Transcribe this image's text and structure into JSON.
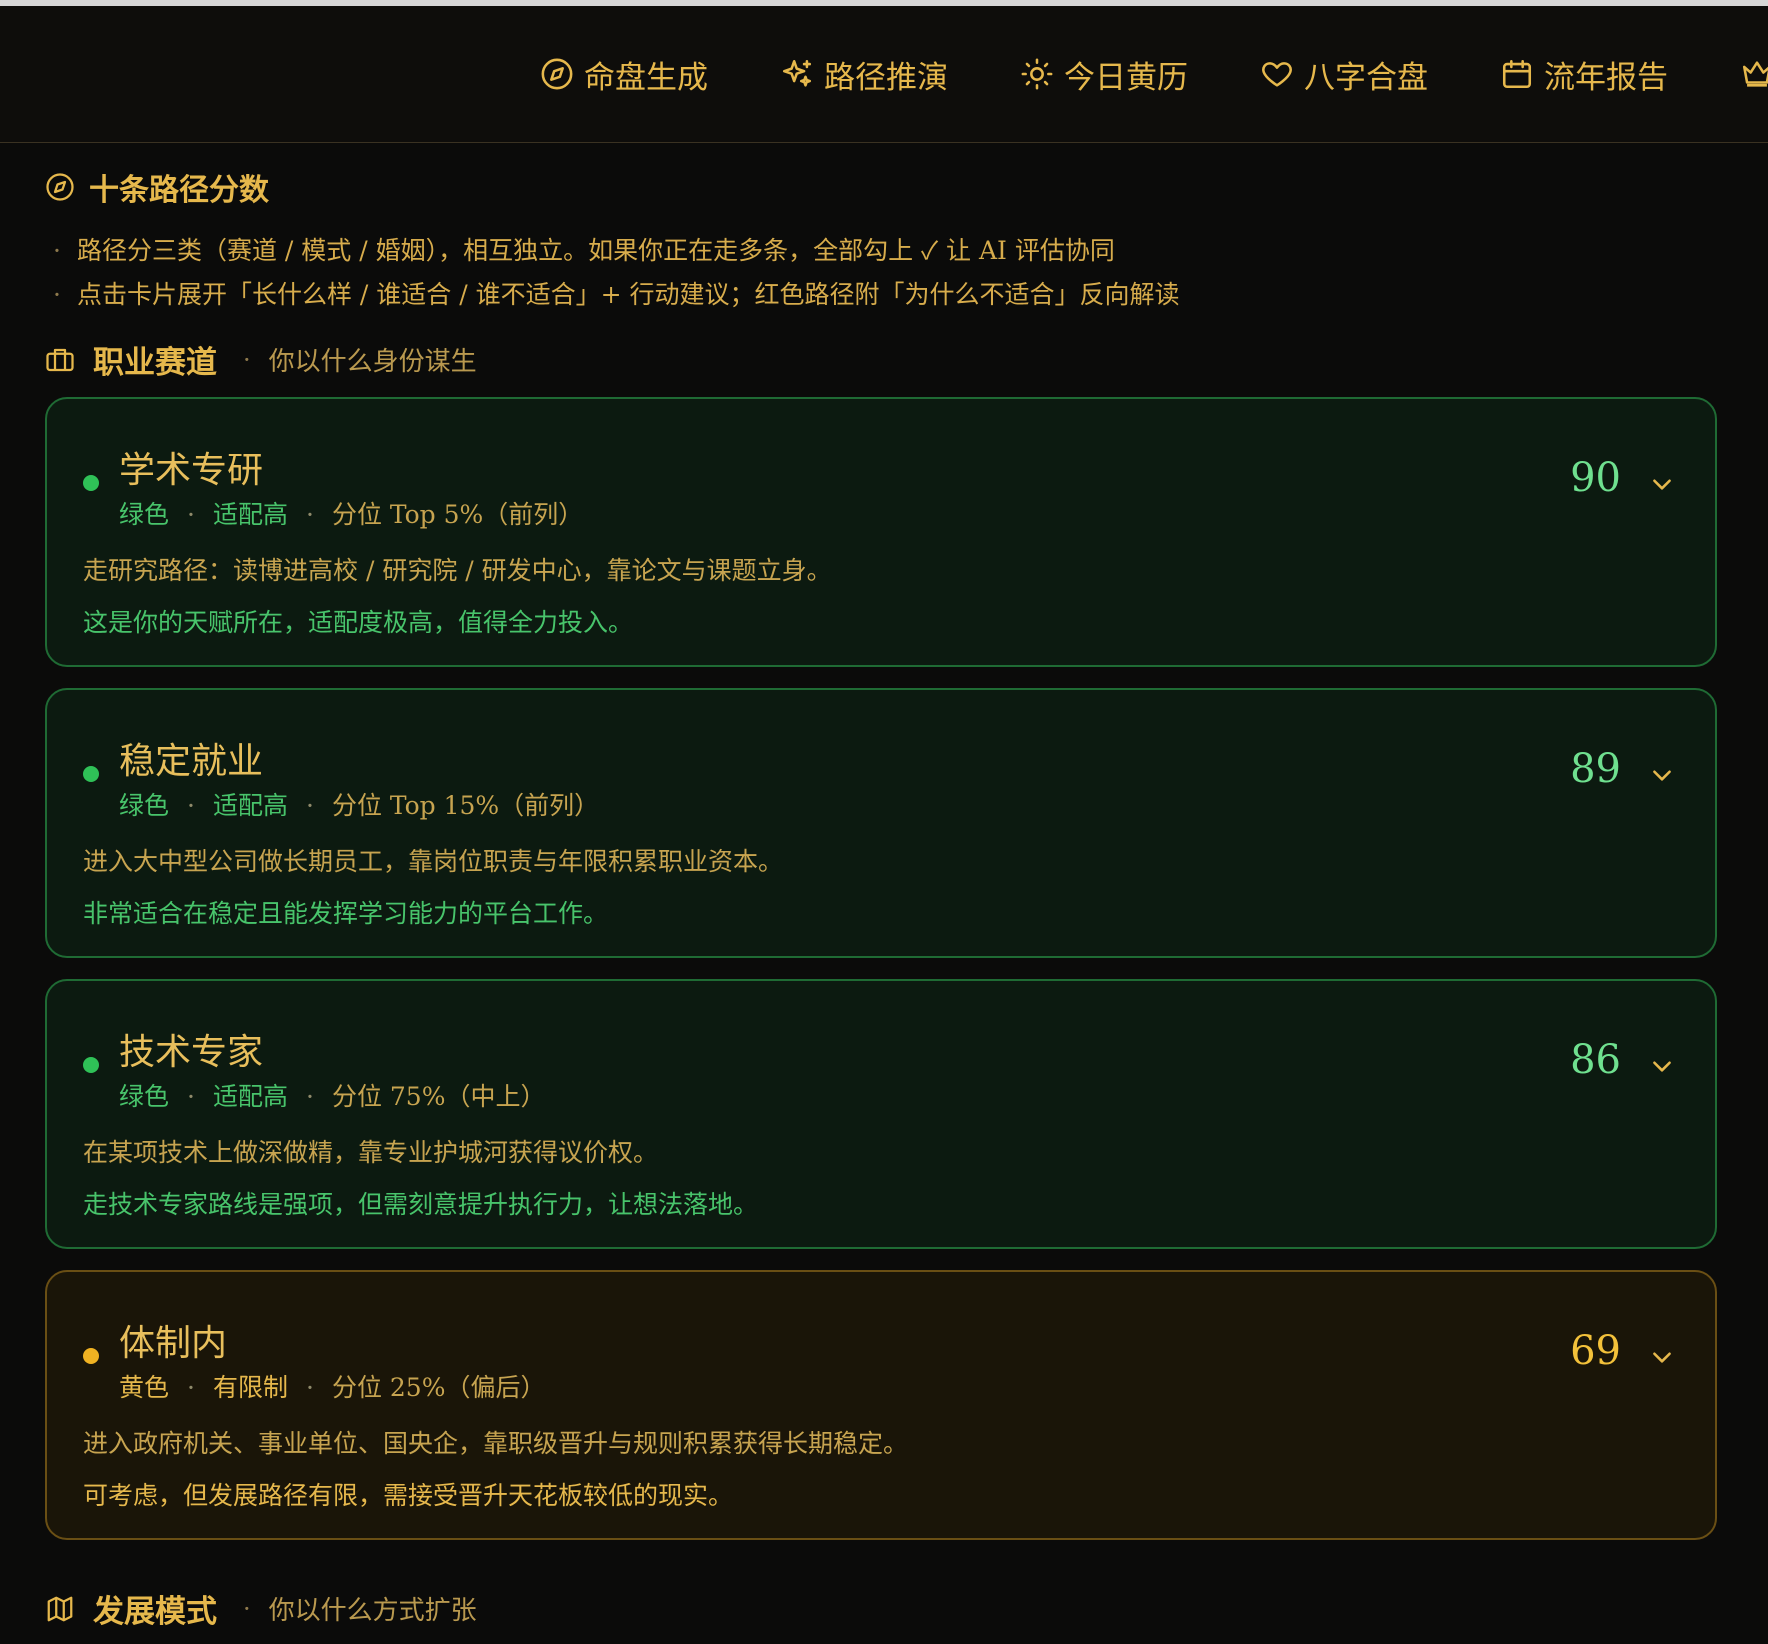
{
  "nav": {
    "items": [
      {
        "label": "命盘生成",
        "icon": "compass-icon"
      },
      {
        "label": "路径推演",
        "icon": "sparkles-icon"
      },
      {
        "label": "今日黄历",
        "icon": "sun-icon"
      },
      {
        "label": "八字合盘",
        "icon": "heart-icon"
      },
      {
        "label": "流年报告",
        "icon": "calendar-icon"
      },
      {
        "label": "",
        "icon": "crown-icon"
      }
    ]
  },
  "section": {
    "title": "十条路径分数",
    "bullets": [
      "路径分三类（赛道 / 模式 / 婚姻），相互独立。如果你正在走多条，全部勾上 ✓ 让 AI 评估协同",
      "点击卡片展开「长什么样 / 谁适合 / 谁不适合」+ 行动建议；红色路径附「为什么不适合」反向解读"
    ],
    "bullet_dot": "·"
  },
  "groups": [
    {
      "title": "职业赛道",
      "sep": "·",
      "subtitle": "你以什么身份谋生"
    },
    {
      "title": "发展模式",
      "sep": "·",
      "subtitle": "你以什么方式扩张"
    }
  ],
  "cards": [
    {
      "name": "学术专研",
      "color_label": "绿色",
      "fit_label": "适配高",
      "rank": "分位 Top 5%（前列）",
      "desc": "走研究路径：读博进高校 / 研究院 / 研发中心，靠论文与课题立身。",
      "advice": "这是你的天赋所在，适配度极高，值得全力投入。",
      "score": "90",
      "variant": "green"
    },
    {
      "name": "稳定就业",
      "color_label": "绿色",
      "fit_label": "适配高",
      "rank": "分位 Top 15%（前列）",
      "desc": "进入大中型公司做长期员工，靠岗位职责与年限积累职业资本。",
      "advice": "非常适合在稳定且能发挥学习能力的平台工作。",
      "score": "89",
      "variant": "green"
    },
    {
      "name": "技术专家",
      "color_label": "绿色",
      "fit_label": "适配高",
      "rank": "分位 75%（中上）",
      "desc": "在某项技术上做深做精，靠专业护城河获得议价权。",
      "advice": "走技术专家路线是强项，但需刻意提升执行力，让想法落地。",
      "score": "86",
      "variant": "green"
    },
    {
      "name": "体制内",
      "color_label": "黄色",
      "fit_label": "有限制",
      "rank": "分位 25%（偏后）",
      "desc": "进入政府机关、事业单位、国央企，靠职级晋升与规则积累获得长期稳定。",
      "advice": "可考虑，但发展路径有限，需接受晋升天花板较低的现实。",
      "score": "69",
      "variant": "yellow"
    }
  ],
  "meta_sep": "·",
  "colors": {
    "accent": "#e6b84c",
    "green": "#2fc157",
    "yellow": "#f0b222",
    "background": "#0b0b0a"
  }
}
